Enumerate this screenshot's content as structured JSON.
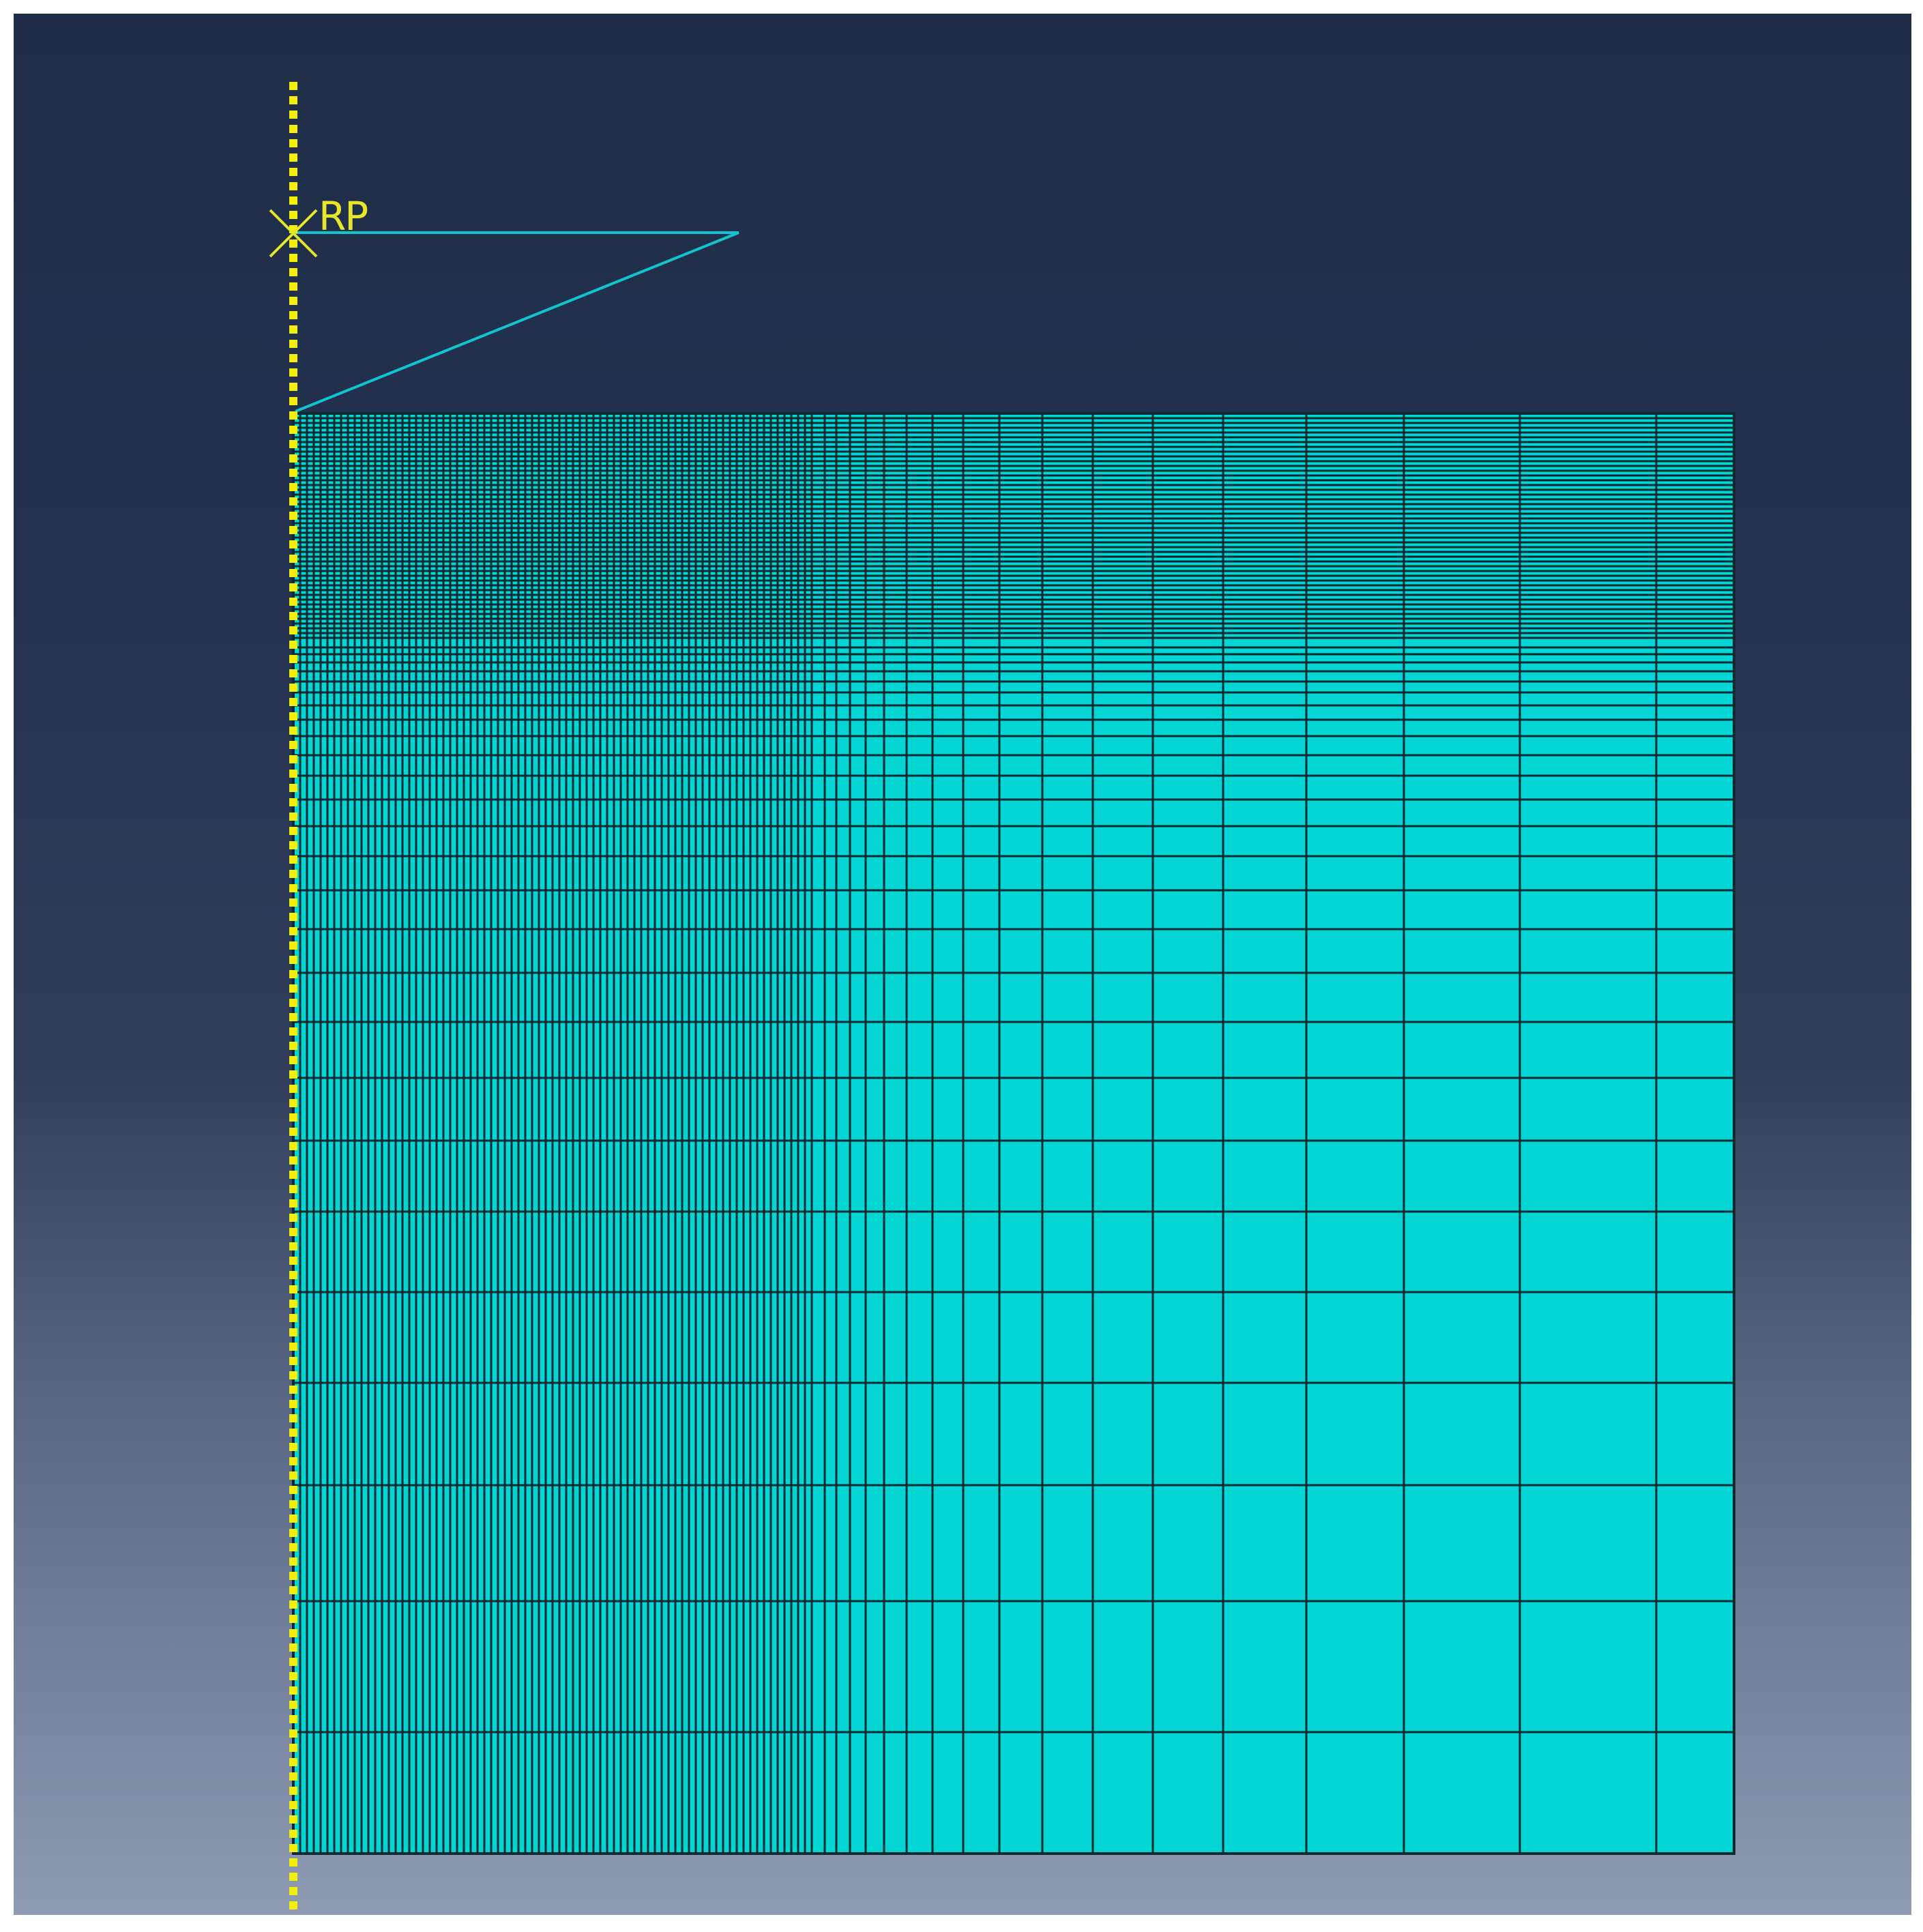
{
  "reference_point": {
    "label": "RP",
    "color": "#e6e62a"
  },
  "colors": {
    "background_top": "#1f2d47",
    "background_bottom": "#8e9bb3",
    "mesh_fill": "#04d6d6",
    "mesh_line": "#0c2a30",
    "indenter_line": "#12c4cf",
    "symmetry_axis": "#f4ef0a"
  },
  "icons": {
    "reference_point_marker": "x-cross-icon"
  }
}
